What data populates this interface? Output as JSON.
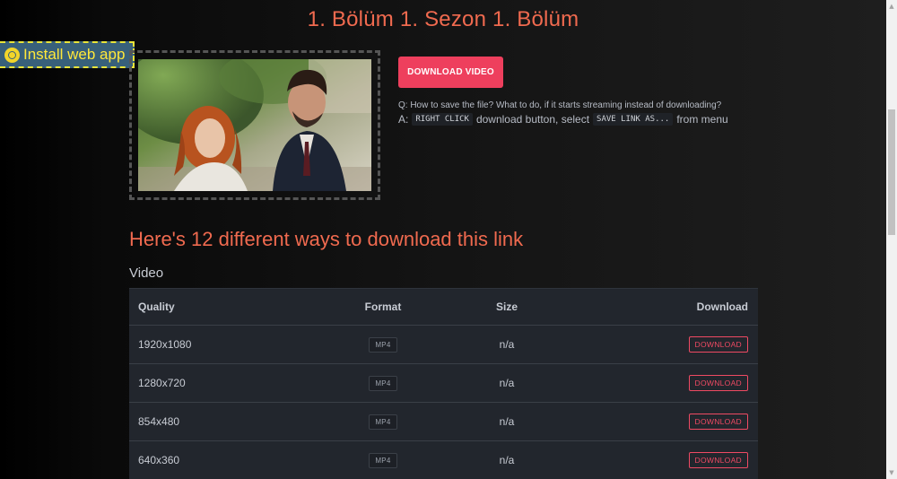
{
  "page": {
    "title": "1. Bölüm 1. Sezon 1. Bölüm"
  },
  "install_app": {
    "label": "Install web app",
    "icon": "chrome-icon"
  },
  "main": {
    "download_video_label": "DOWNLOAD VIDEO",
    "faq_question": "Q: How to save the file? What to do, if it starts streaming instead of downloading?",
    "faq_answer": {
      "prefix": "A:",
      "key1": "RIGHT CLICK",
      "middle": "download button, select",
      "key2": "SAVE LINK AS...",
      "suffix": "from menu"
    },
    "ways_heading": "Here's 12 different ways to download this link",
    "section_label": "Video"
  },
  "table": {
    "headers": {
      "quality": "Quality",
      "format": "Format",
      "size": "Size",
      "download": "Download"
    },
    "rows": [
      {
        "quality": "1920x1080",
        "format": "MP4",
        "size": "n/a",
        "download": "DOWNLOAD"
      },
      {
        "quality": "1280x720",
        "format": "MP4",
        "size": "n/a",
        "download": "DOWNLOAD"
      },
      {
        "quality": "854x480",
        "format": "MP4",
        "size": "n/a",
        "download": "DOWNLOAD"
      },
      {
        "quality": "640x360",
        "format": "MP4",
        "size": "n/a",
        "download": "DOWNLOAD"
      }
    ]
  },
  "colors": {
    "accent_title": "#f06a4f",
    "download_button": "#ee3f5d",
    "install_badge_bg": "#38607a",
    "install_badge_text": "#ffe73a"
  }
}
